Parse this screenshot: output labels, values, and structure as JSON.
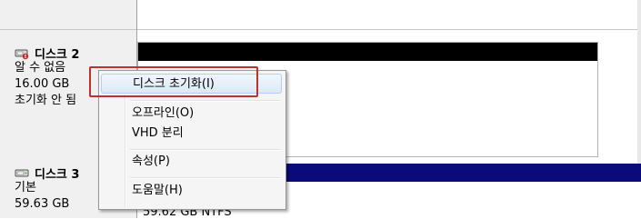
{
  "disks": [
    {
      "name": "디스크 2",
      "lines": [
        "알 수 없음",
        "16.00 GB",
        "초기화 안 됨"
      ]
    },
    {
      "name": "디스크 3",
      "lines": [
        "기본",
        "59.63 GB"
      ]
    }
  ],
  "partition3": {
    "info": "59.62 GB NTFS"
  },
  "context_menu": {
    "items": [
      "디스크 초기화(I)",
      "오프라인(O)",
      "VHD 분리",
      "속성(P)",
      "도움말(H)"
    ],
    "highlighted": 0
  },
  "colors": {
    "partition_unallocated_bar": "#000000",
    "partition_primary_bar": "#0a0a7a",
    "highlight_box": "#c0312b"
  },
  "icons": [
    "disk-unknown-icon",
    "disk-basic-icon"
  ]
}
